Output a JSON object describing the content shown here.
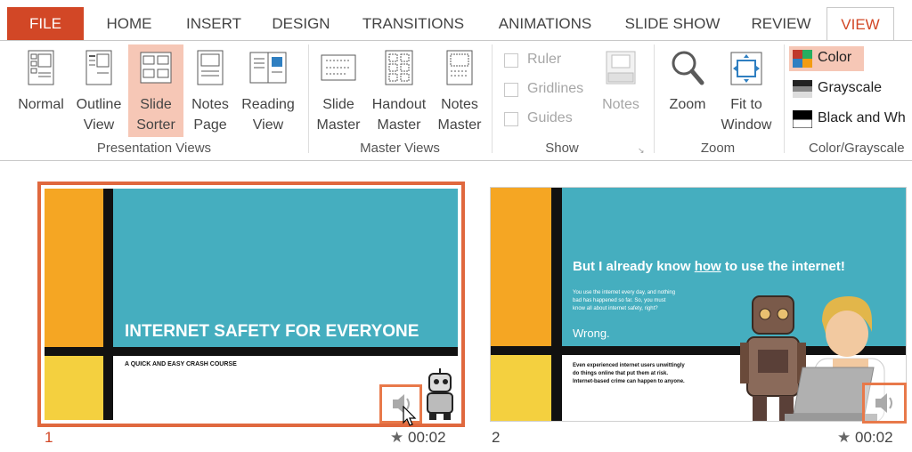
{
  "tabs": [
    {
      "label": "FILE"
    },
    {
      "label": "HOME"
    },
    {
      "label": "INSERT"
    },
    {
      "label": "DESIGN"
    },
    {
      "label": "TRANSITIONS"
    },
    {
      "label": "ANIMATIONS"
    },
    {
      "label": "SLIDE SHOW"
    },
    {
      "label": "REVIEW"
    },
    {
      "label": "VIEW"
    }
  ],
  "ribbon": {
    "presentation_views": {
      "label": "Presentation Views",
      "buttons": [
        {
          "line1": "Normal",
          "line2": ""
        },
        {
          "line1": "Outline",
          "line2": "View"
        },
        {
          "line1": "Slide",
          "line2": "Sorter"
        },
        {
          "line1": "Notes",
          "line2": "Page"
        },
        {
          "line1": "Reading",
          "line2": "View"
        }
      ]
    },
    "master_views": {
      "label": "Master Views",
      "buttons": [
        {
          "line1": "Slide",
          "line2": "Master"
        },
        {
          "line1": "Handout",
          "line2": "Master"
        },
        {
          "line1": "Notes",
          "line2": "Master"
        }
      ]
    },
    "show": {
      "label": "Show",
      "checkboxes": [
        {
          "label": "Ruler",
          "checked": false
        },
        {
          "label": "Gridlines",
          "checked": false
        },
        {
          "label": "Guides",
          "checked": false
        }
      ],
      "notes_label": "Notes"
    },
    "zoom": {
      "label": "Zoom",
      "zoom_button": "Zoom",
      "fit_line1": "Fit to",
      "fit_line2": "Window"
    },
    "color": {
      "label": "Color/Grayscale",
      "options": [
        {
          "label": "Color",
          "selected": true
        },
        {
          "label": "Grayscale",
          "selected": false
        },
        {
          "label": "Black and Wh",
          "selected": false
        }
      ]
    }
  },
  "slides": [
    {
      "number": "1",
      "time": "00:02",
      "title": "INTERNET SAFETY FOR EVERYONE",
      "subtitle": "A QUICK AND EASY CRASH COURSE"
    },
    {
      "number": "2",
      "time": "00:02",
      "title_pre": "But I already know ",
      "title_link": "how",
      "title_post": " to use the internet!",
      "body_line1": "You use the internet every day, and nothing",
      "body_line2": "bad has happened so far. So, you must",
      "body_line3": "know all about internet safety, right?",
      "wrong": "Wrong.",
      "foot_line1": "Even experienced internet users unwittingly",
      "foot_line2": "do things online that put them at risk.",
      "foot_line3": "Internet-based crime can happen to anyone."
    }
  ],
  "colors": {
    "accent": "#d24726",
    "teal": "#45aebf",
    "orange": "#f5a623",
    "yellow": "#f4d03f",
    "selection": "#f6c7b6"
  }
}
